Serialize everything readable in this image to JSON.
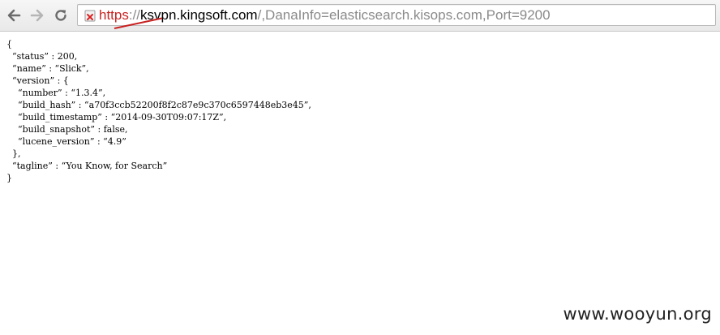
{
  "browser": {
    "url": {
      "scheme": "https",
      "separator": "://",
      "host": "ksvpn.kingsoft.com",
      "path": "/,DanaInfo=elasticsearch.kisops.com,Port=9200"
    },
    "icons": {
      "back": "back-arrow-icon",
      "forward": "forward-arrow-icon",
      "reload": "reload-icon",
      "security": "broken-https-icon"
    },
    "colors": {
      "scheme_strike": "#c82222"
    }
  },
  "page": {
    "json_lines": [
      "{",
      "  “status” : 200,",
      "  “name” : “Slick”,",
      "  “version” : {",
      "    “number” : “1.3.4”,",
      "    “build_hash” : “a70f3ccb52200f8f2c87e9c370c6597448eb3e45”,",
      "    “build_timestamp” : “2014-09-30T09:07:17Z”,",
      "    “build_snapshot” : false,",
      "    “lucene_version” : “4.9”",
      "  },",
      "  “tagline” : “You Know, for Search”",
      "}"
    ]
  },
  "watermark": "www.wooyun.org"
}
